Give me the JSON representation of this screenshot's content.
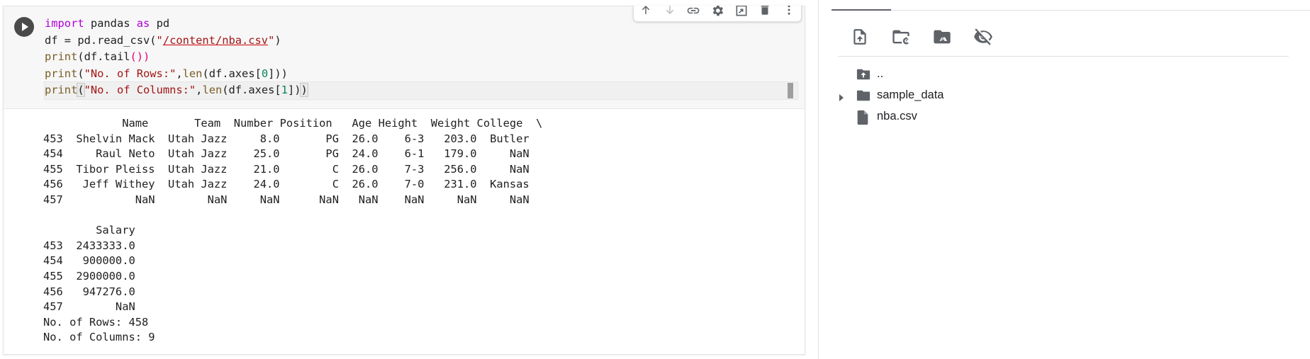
{
  "cell": {
    "run_button": "run-cell",
    "code_lines": [
      [
        {
          "t": "import",
          "c": "kw"
        },
        {
          "t": " pandas ",
          "c": ""
        },
        {
          "t": "as",
          "c": "kw"
        },
        {
          "t": " pd",
          "c": ""
        }
      ],
      [
        {
          "t": "df = pd.read_csv(",
          "c": ""
        },
        {
          "t": "\"",
          "c": "str"
        },
        {
          "t": "/content/nba.csv",
          "c": "str ul"
        },
        {
          "t": "\"",
          "c": "str"
        },
        {
          "t": ")",
          "c": ""
        }
      ],
      [
        {
          "t": "print",
          "c": "fn"
        },
        {
          "t": "(df.tail",
          "c": ""
        },
        {
          "t": "())",
          "c": "pink"
        }
      ],
      [
        {
          "t": "print",
          "c": "fn"
        },
        {
          "t": "(",
          "c": ""
        },
        {
          "t": "\"No. of Rows:\"",
          "c": "str"
        },
        {
          "t": ",",
          "c": ""
        },
        {
          "t": "len",
          "c": "fn"
        },
        {
          "t": "(df.axes[",
          "c": ""
        },
        {
          "t": "0",
          "c": "num"
        },
        {
          "t": "]))",
          "c": ""
        }
      ],
      [
        {
          "t": "print",
          "c": "fn"
        },
        {
          "t": "(",
          "c": "bracket-hl"
        },
        {
          "t": "\"No. of Columns:\"",
          "c": "str"
        },
        {
          "t": ",",
          "c": ""
        },
        {
          "t": "len",
          "c": "fn"
        },
        {
          "t": "(df.axes[",
          "c": ""
        },
        {
          "t": "1",
          "c": "num"
        },
        {
          "t": "])",
          "c": ""
        },
        {
          "t": ")",
          "c": "bracket-hl"
        }
      ]
    ],
    "toolbar": [
      "move-up",
      "move-down",
      "link",
      "settings",
      "mirror-cell",
      "delete",
      "more"
    ],
    "output_lines": [
      "            Name       Team  Number Position   Age Height  Weight College  \\",
      "453  Shelvin Mack  Utah Jazz     8.0       PG  26.0    6-3   203.0  Butler",
      "454     Raul Neto  Utah Jazz    25.0       PG  24.0    6-1   179.0     NaN",
      "455  Tibor Pleiss  Utah Jazz    21.0        C  26.0    7-3   256.0     NaN",
      "456   Jeff Withey  Utah Jazz    24.0        C  26.0    7-0   231.0  Kansas",
      "457           NaN        NaN     NaN      NaN   NaN    NaN     NaN     NaN",
      "",
      "        Salary",
      "453  2433333.0",
      "454   900000.0",
      "455  2900000.0",
      "456   947276.0",
      "457        NaN",
      "No. of Rows: 458",
      "No. of Columns: 9"
    ]
  },
  "files_panel": {
    "actions": [
      "upload-file",
      "refresh",
      "mount-drive",
      "hide-files"
    ],
    "tree": [
      {
        "label": "..",
        "icon": "folder-up",
        "expandable": false
      },
      {
        "label": "sample_data",
        "icon": "folder",
        "expandable": true
      },
      {
        "label": "nba.csv",
        "icon": "file",
        "expandable": false
      }
    ]
  },
  "colors": {
    "keyword": "#af00db",
    "function": "#795e26",
    "string": "#a31515",
    "number": "#098658",
    "icon": "#5f6368"
  }
}
